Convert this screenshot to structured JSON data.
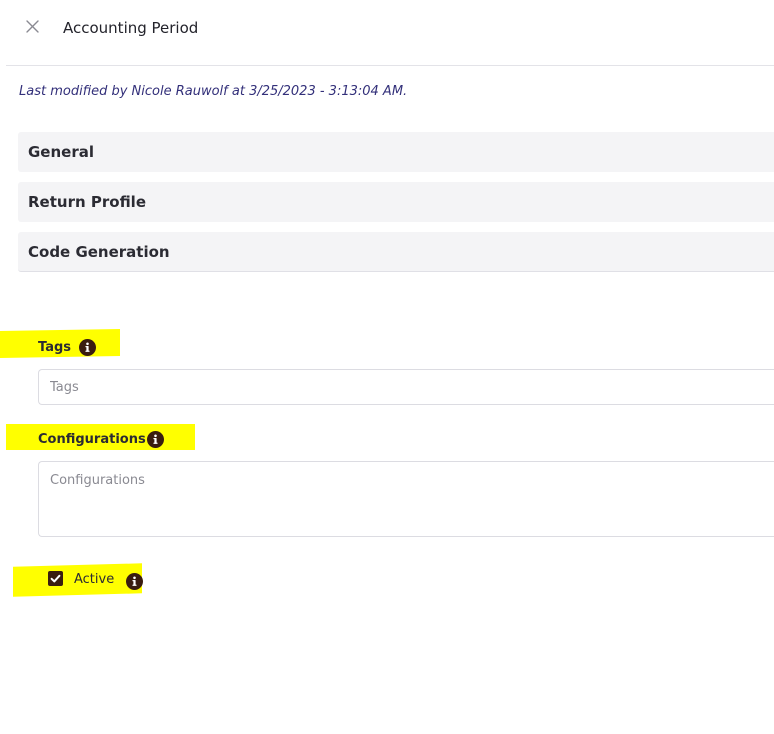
{
  "header": {
    "title": "Accounting Period",
    "close_icon": "close-icon"
  },
  "meta": {
    "last_modified": "Last modified by Nicole Rauwolf at 3/25/2023 - 3:13:04 AM."
  },
  "sections": [
    {
      "label": "General"
    },
    {
      "label": "Return Profile"
    },
    {
      "label": "Code Generation"
    }
  ],
  "fields": {
    "tags": {
      "label": "Tags",
      "placeholder": "Tags",
      "value": "",
      "info_icon": "info-icon"
    },
    "configurations": {
      "label": "Configurations",
      "placeholder": "Configurations",
      "value": "",
      "info_icon": "info-icon"
    },
    "active": {
      "label": "Active",
      "checked": true,
      "info_icon": "info-icon"
    }
  },
  "colors": {
    "highlight": "#ffff00",
    "accent_dark": "#3a1d10",
    "modified_text": "#33307a",
    "section_bg": "#f4f4f6"
  }
}
